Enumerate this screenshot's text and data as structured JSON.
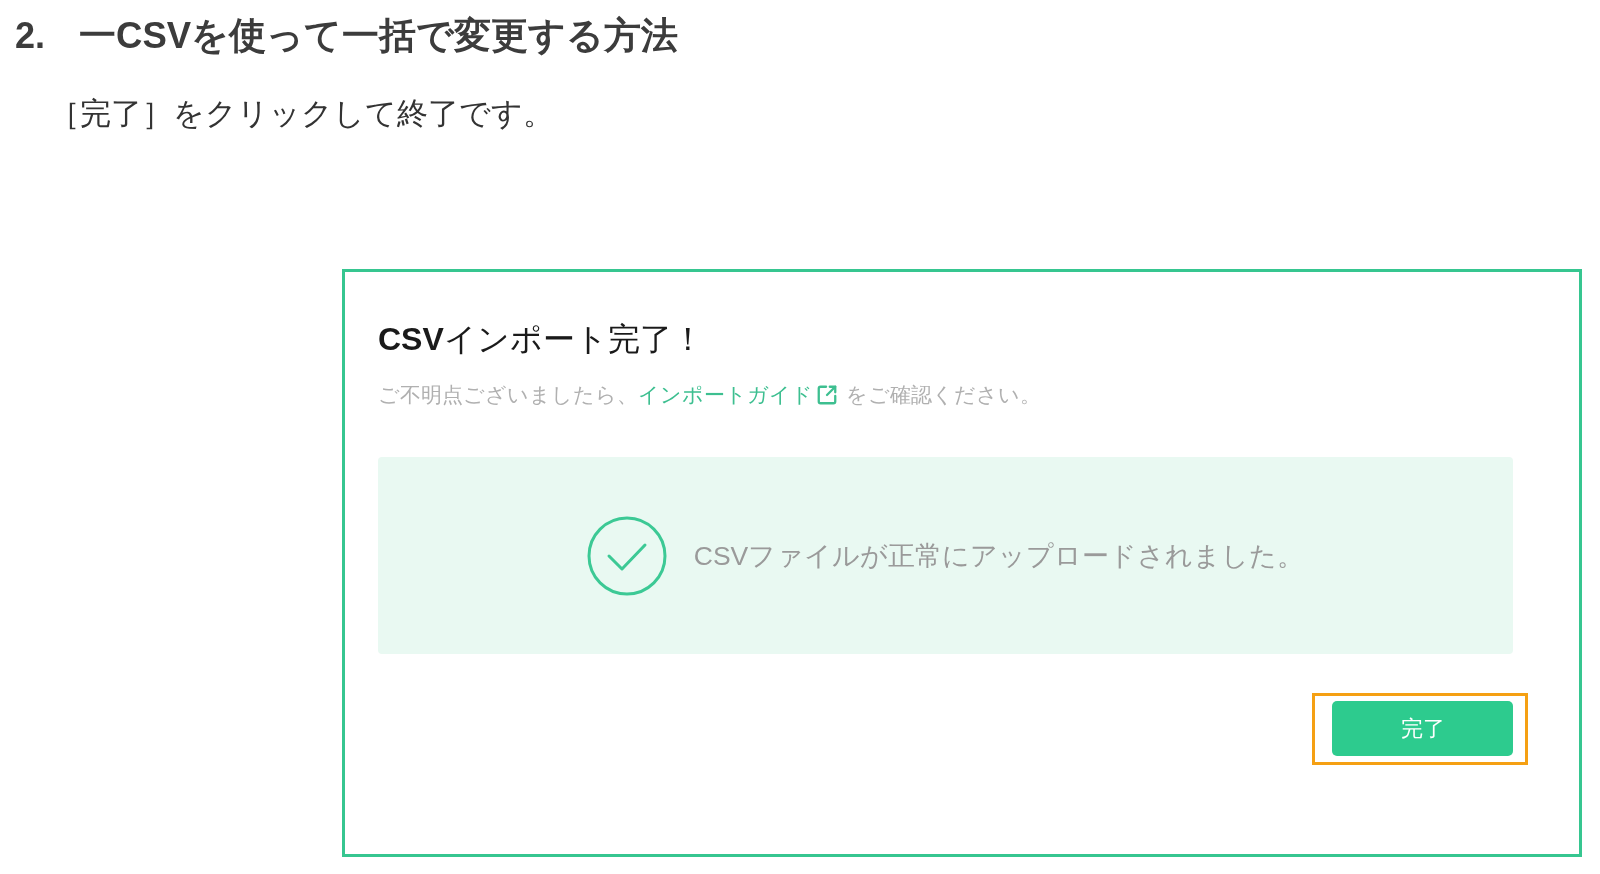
{
  "heading": {
    "number": "2.",
    "text": "一CSVを使って一括で変更する方法"
  },
  "instruction": "［完了］をクリックして終了です。",
  "screenshot": {
    "title": "**CSV**インポート完了！",
    "help": {
      "before": "ご不明点ございましたら、",
      "link": "インポートガイド",
      "after": "をご確認ください。"
    },
    "message": "CSVファイルが正常にアップロードされました。",
    "button": {
      "label": "完了",
      "highlighted": true
    }
  }
}
